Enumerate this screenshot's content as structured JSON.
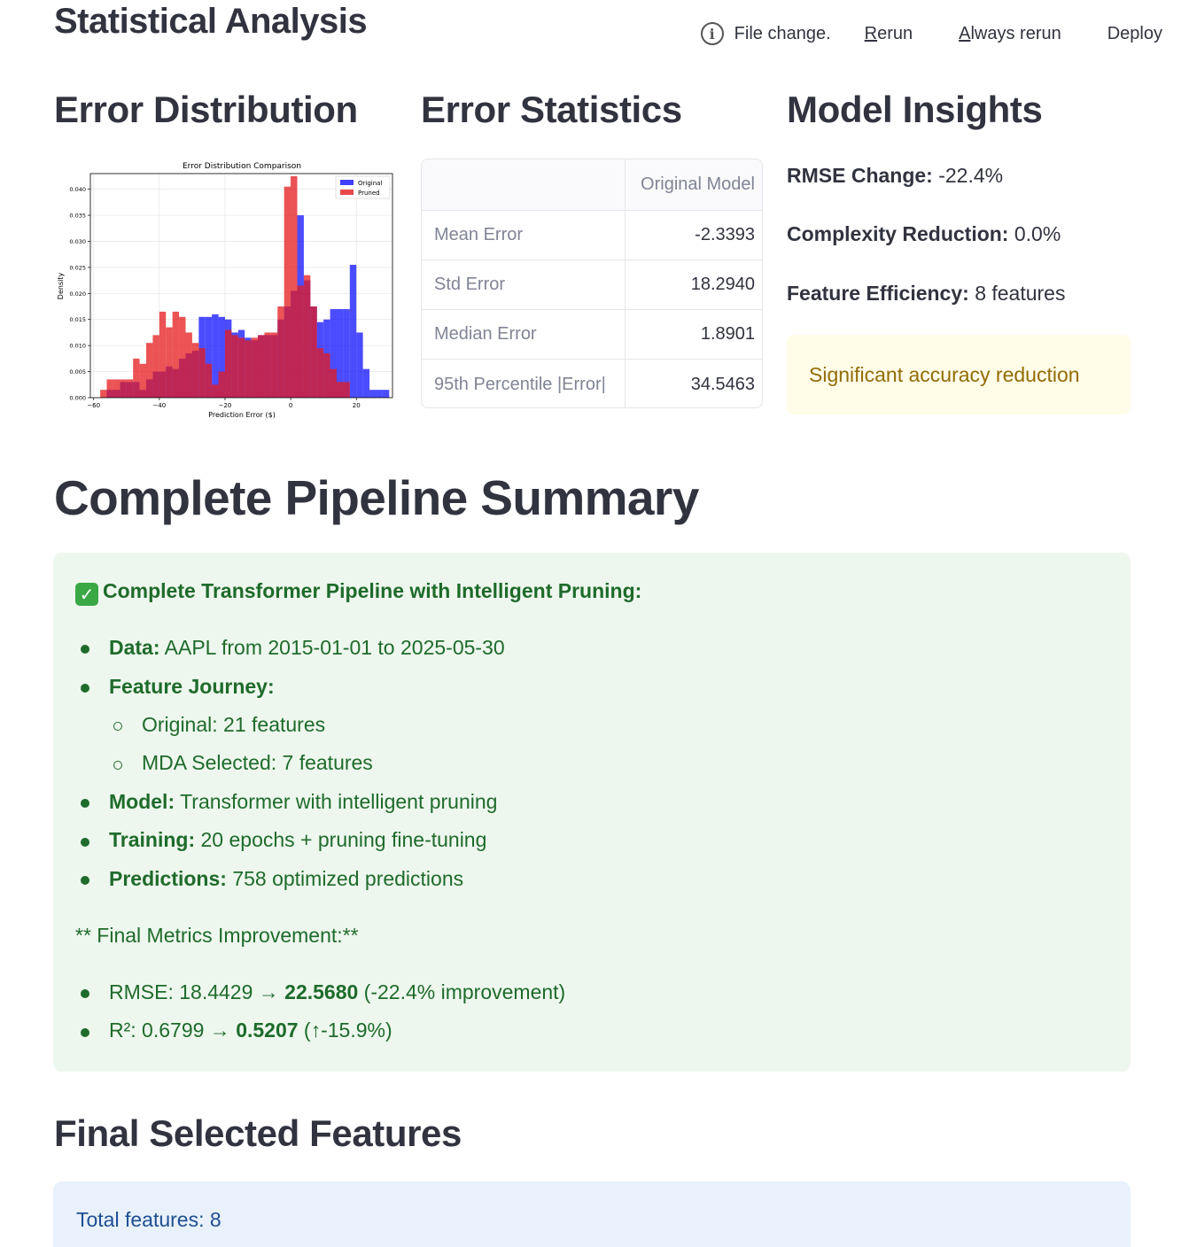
{
  "header": {
    "title": "Statistical Analysis",
    "status_text": "File change.",
    "rerun_label": "Rerun",
    "always_rerun_label": "Always rerun",
    "deploy_label": "Deploy"
  },
  "columns": {
    "distribution_title": "Error Distribution",
    "statistics_title": "Error Statistics",
    "insights_title": "Model Insights"
  },
  "chart_data": {
    "type": "histogram",
    "title": "Error Distribution Comparison",
    "xlabel": "Prediction Error ($)",
    "ylabel": "Density",
    "xlim": [
      -61,
      31
    ],
    "ylim": [
      0,
      0.043
    ],
    "xticks": [
      -60,
      -40,
      -20,
      0,
      20
    ],
    "yticks": [
      0.0,
      0.005,
      0.01,
      0.015,
      0.02,
      0.025,
      0.03,
      0.035,
      0.04
    ],
    "grid": true,
    "legend_position": "top-right",
    "series": [
      {
        "name": "Original",
        "color": "#0000ff",
        "alpha": 0.7,
        "bins": [
          [
            -56,
            -54,
            0.0015
          ],
          [
            -54,
            -52,
            0.0015
          ],
          [
            -52,
            -50,
            0.003
          ],
          [
            -50,
            -48,
            0.003
          ],
          [
            -48,
            -46,
            0.003
          ],
          [
            -46,
            -44,
            0.0015
          ],
          [
            -44,
            -42,
            0.0035
          ],
          [
            -42,
            -40,
            0.005
          ],
          [
            -40,
            -38,
            0.005
          ],
          [
            -38,
            -36,
            0.006
          ],
          [
            -36,
            -34,
            0.0055
          ],
          [
            -34,
            -32,
            0.0075
          ],
          [
            -32,
            -30,
            0.0085
          ],
          [
            -30,
            -28,
            0.009
          ],
          [
            -28,
            -26,
            0.0155
          ],
          [
            -26,
            -24,
            0.0155
          ],
          [
            -24,
            -22,
            0.016
          ],
          [
            -22,
            -20,
            0.0155
          ],
          [
            -20,
            -18,
            0.015
          ],
          [
            -18,
            -16,
            0.0125
          ],
          [
            -16,
            -14,
            0.013
          ],
          [
            -14,
            -12,
            0.0115
          ],
          [
            -12,
            -10,
            0.011
          ],
          [
            -10,
            -8,
            0.012
          ],
          [
            -8,
            -6,
            0.012
          ],
          [
            -6,
            -4,
            0.012
          ],
          [
            -4,
            -2,
            0.015
          ],
          [
            -2,
            0,
            0.0175
          ],
          [
            0,
            2,
            0.0205
          ],
          [
            2,
            4,
            0.035
          ],
          [
            4,
            6,
            0.0225
          ],
          [
            6,
            8,
            0.0175
          ],
          [
            8,
            10,
            0.0145
          ],
          [
            10,
            12,
            0.015
          ],
          [
            12,
            14,
            0.017
          ],
          [
            14,
            16,
            0.017
          ],
          [
            16,
            18,
            0.017
          ],
          [
            18,
            20,
            0.0255
          ],
          [
            20,
            22,
            0.0125
          ],
          [
            22,
            24,
            0.0055
          ],
          [
            24,
            26,
            0.0015
          ],
          [
            26,
            28,
            0.0015
          ],
          [
            28,
            30,
            0.0015
          ]
        ]
      },
      {
        "name": "Pruned",
        "color": "#e41a1c",
        "alpha": 0.75,
        "bins": [
          [
            -58,
            -56,
            0.0015
          ],
          [
            -56,
            -54,
            0.0035
          ],
          [
            -54,
            -52,
            0.0035
          ],
          [
            -52,
            -50,
            0.0035
          ],
          [
            -50,
            -48,
            0.0035
          ],
          [
            -48,
            -46,
            0.0075
          ],
          [
            -46,
            -44,
            0.0065
          ],
          [
            -44,
            -42,
            0.0105
          ],
          [
            -42,
            -40,
            0.012
          ],
          [
            -40,
            -38,
            0.0165
          ],
          [
            -38,
            -36,
            0.0135
          ],
          [
            -36,
            -34,
            0.0165
          ],
          [
            -34,
            -32,
            0.0155
          ],
          [
            -32,
            -30,
            0.0125
          ],
          [
            -30,
            -28,
            0.0105
          ],
          [
            -28,
            -26,
            0.0095
          ],
          [
            -26,
            -24,
            0.0065
          ],
          [
            -24,
            -22,
            0.0025
          ],
          [
            -22,
            -20,
            0.005
          ],
          [
            -20,
            -18,
            0.013
          ],
          [
            -18,
            -16,
            0.012
          ],
          [
            -16,
            -14,
            0.0115
          ],
          [
            -14,
            -12,
            0.011
          ],
          [
            -12,
            -10,
            0.0115
          ],
          [
            -10,
            -8,
            0.012
          ],
          [
            -8,
            -6,
            0.0125
          ],
          [
            -6,
            -4,
            0.0125
          ],
          [
            -4,
            -2,
            0.0175
          ],
          [
            -2,
            0,
            0.0405
          ],
          [
            0,
            2,
            0.0425
          ],
          [
            2,
            4,
            0.0215
          ],
          [
            4,
            6,
            0.0235
          ],
          [
            6,
            8,
            0.0175
          ],
          [
            8,
            10,
            0.0095
          ],
          [
            10,
            12,
            0.0085
          ],
          [
            12,
            14,
            0.0055
          ],
          [
            14,
            16,
            0.003
          ],
          [
            16,
            18,
            0.003
          ]
        ]
      }
    ]
  },
  "stats_table": {
    "header": [
      "",
      "Original Model"
    ],
    "rows": [
      {
        "label": "Mean Error",
        "value": "-2.3393"
      },
      {
        "label": "Std Error",
        "value": "18.2940"
      },
      {
        "label": "Median Error",
        "value": "1.8901"
      },
      {
        "label": "95th Percentile |Error|",
        "value": "34.5463"
      }
    ]
  },
  "insights": {
    "rmse_label": "RMSE Change:",
    "rmse_value": "-22.4%",
    "complexity_label": "Complexity Reduction:",
    "complexity_value": "0.0%",
    "efficiency_label": "Feature Efficiency:",
    "efficiency_value": "8 features",
    "warning": "Significant accuracy reduction",
    "warning_color": "#926c05"
  },
  "pipeline": {
    "title": "Complete Pipeline Summary",
    "check_icon": "✓",
    "heading": "Complete Transformer Pipeline with Intelligent Pruning:",
    "data_label": "Data:",
    "data_value": "AAPL from 2015-01-01 to 2025-05-30",
    "journey_label": "Feature Journey:",
    "journey_original": "Original: 21 features",
    "journey_mda": "MDA Selected: 7 features",
    "model_label": "Model:",
    "model_value": "Transformer with intelligent pruning",
    "training_label": "Training:",
    "training_value": "20 epochs + pruning fine-tuning",
    "predictions_label": "Predictions:",
    "predictions_value": "758 optimized predictions",
    "metrics_heading": "** Final Metrics Improvement:**",
    "rmse_prefix": "RMSE: 18.4429 → ",
    "rmse_new": "22.5680",
    "rmse_suffix": " (-22.4% improvement)",
    "r2_prefix": "R²: 0.6799 → ",
    "r2_new": "0.5207",
    "r2_suffix": " (↑-15.9%)",
    "success_color": "#1e6b2b"
  },
  "final_features": {
    "title": "Final Selected Features",
    "total": "Total features: 8"
  }
}
